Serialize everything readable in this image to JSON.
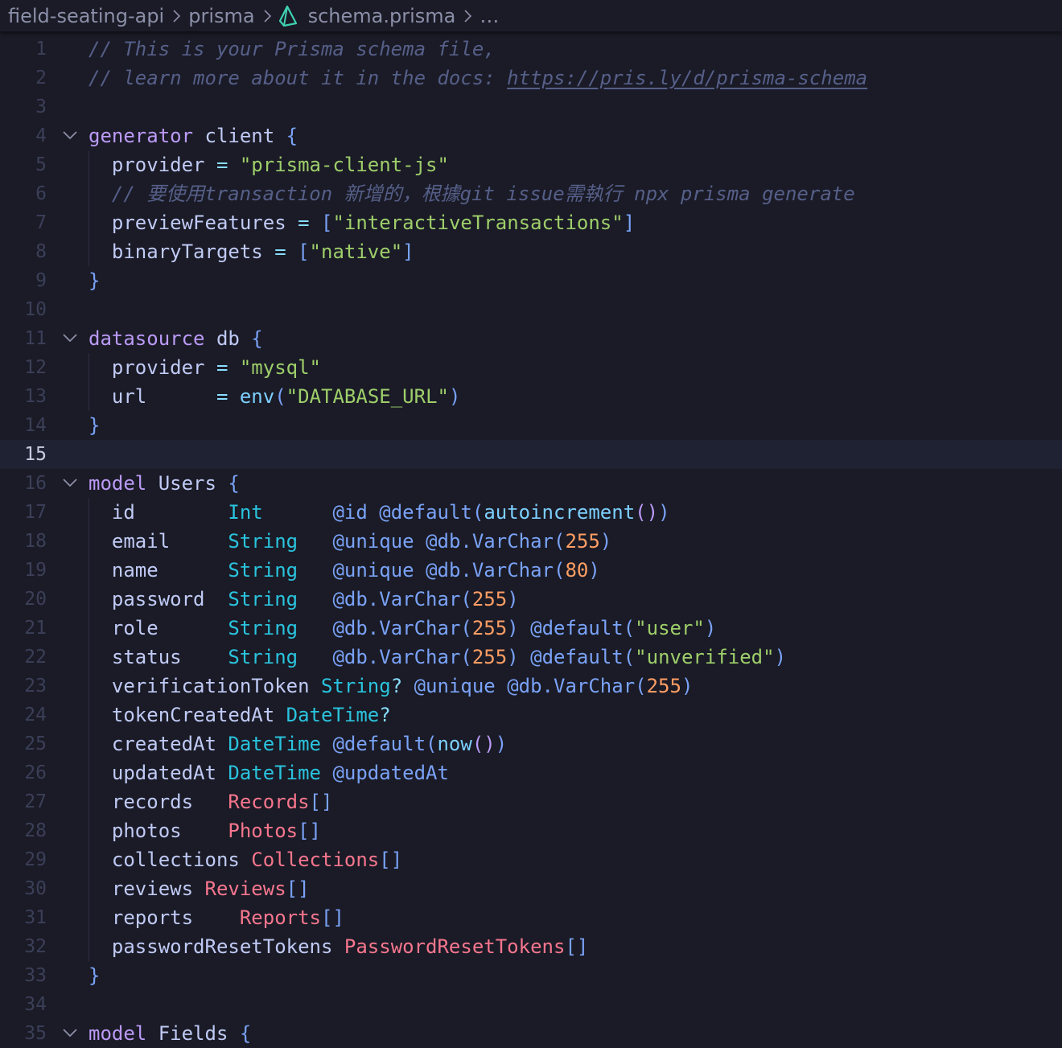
{
  "breadcrumb": {
    "folder": "field-seating-api",
    "subfolder": "prisma",
    "file": "schema.prisma",
    "more": "…",
    "file_icon": "prisma-icon",
    "separator_icon": "chevron-right-icon"
  },
  "editor": {
    "current_line": 15,
    "language": "prisma",
    "lines": [
      {
        "n": "1",
        "fold": false,
        "guide": false,
        "tokens": [
          {
            "t": "// This is your Prisma schema file,",
            "c": "cmt"
          }
        ]
      },
      {
        "n": "2",
        "fold": false,
        "guide": false,
        "tokens": [
          {
            "t": "// learn more about it in the docs: ",
            "c": "cmt"
          },
          {
            "t": "https://pris.ly/d/prisma-schema",
            "c": "cmt url"
          }
        ]
      },
      {
        "n": "3",
        "fold": false,
        "guide": false,
        "tokens": []
      },
      {
        "n": "4",
        "fold": true,
        "guide": false,
        "tokens": [
          {
            "t": "generator",
            "c": "kw"
          },
          {
            "t": " client ",
            "c": "id"
          },
          {
            "t": "{",
            "c": "br"
          }
        ]
      },
      {
        "n": "5",
        "fold": false,
        "guide": true,
        "tokens": [
          {
            "t": "  provider ",
            "c": "id"
          },
          {
            "t": "=",
            "c": "op"
          },
          {
            "t": " ",
            "c": "id"
          },
          {
            "t": "\"prisma-client-js\"",
            "c": "str"
          }
        ]
      },
      {
        "n": "6",
        "fold": false,
        "guide": true,
        "tokens": [
          {
            "t": "  // 要使用transaction 新增的，根據git issue需執行 npx prisma generate",
            "c": "cmt"
          }
        ]
      },
      {
        "n": "7",
        "fold": false,
        "guide": true,
        "tokens": [
          {
            "t": "  previewFeatures ",
            "c": "id"
          },
          {
            "t": "=",
            "c": "op"
          },
          {
            "t": " ",
            "c": "id"
          },
          {
            "t": "[",
            "c": "br"
          },
          {
            "t": "\"interactiveTransactions\"",
            "c": "str"
          },
          {
            "t": "]",
            "c": "br"
          }
        ]
      },
      {
        "n": "8",
        "fold": false,
        "guide": true,
        "tokens": [
          {
            "t": "  binaryTargets ",
            "c": "id"
          },
          {
            "t": "=",
            "c": "op"
          },
          {
            "t": " ",
            "c": "id"
          },
          {
            "t": "[",
            "c": "br"
          },
          {
            "t": "\"native\"",
            "c": "str"
          },
          {
            "t": "]",
            "c": "br"
          }
        ]
      },
      {
        "n": "9",
        "fold": false,
        "guide": false,
        "tokens": [
          {
            "t": "}",
            "c": "br"
          }
        ]
      },
      {
        "n": "10",
        "fold": false,
        "guide": false,
        "tokens": []
      },
      {
        "n": "11",
        "fold": true,
        "guide": false,
        "tokens": [
          {
            "t": "datasource",
            "c": "kw"
          },
          {
            "t": " db ",
            "c": "id"
          },
          {
            "t": "{",
            "c": "br"
          }
        ]
      },
      {
        "n": "12",
        "fold": false,
        "guide": true,
        "tokens": [
          {
            "t": "  provider ",
            "c": "id"
          },
          {
            "t": "=",
            "c": "op"
          },
          {
            "t": " ",
            "c": "id"
          },
          {
            "t": "\"mysql\"",
            "c": "str"
          }
        ]
      },
      {
        "n": "13",
        "fold": false,
        "guide": true,
        "tokens": [
          {
            "t": "  url      ",
            "c": "id"
          },
          {
            "t": "=",
            "c": "op"
          },
          {
            "t": " ",
            "c": "id"
          },
          {
            "t": "env",
            "c": "fn"
          },
          {
            "t": "(",
            "c": "br"
          },
          {
            "t": "\"DATABASE_URL\"",
            "c": "str"
          },
          {
            "t": ")",
            "c": "br"
          }
        ]
      },
      {
        "n": "14",
        "fold": false,
        "guide": false,
        "tokens": [
          {
            "t": "}",
            "c": "br"
          }
        ]
      },
      {
        "n": "15",
        "fold": false,
        "guide": false,
        "tokens": []
      },
      {
        "n": "16",
        "fold": true,
        "guide": false,
        "tokens": [
          {
            "t": "model",
            "c": "kw"
          },
          {
            "t": " Users ",
            "c": "id"
          },
          {
            "t": "{",
            "c": "br"
          }
        ]
      },
      {
        "n": "17",
        "fold": false,
        "guide": true,
        "tokens": [
          {
            "t": "  id        ",
            "c": "id"
          },
          {
            "t": "Int",
            "c": "ty"
          },
          {
            "t": "      ",
            "c": "id"
          },
          {
            "t": "@id",
            "c": "at"
          },
          {
            "t": " ",
            "c": "id"
          },
          {
            "t": "@default",
            "c": "at"
          },
          {
            "t": "(",
            "c": "br"
          },
          {
            "t": "autoincrement",
            "c": "fn"
          },
          {
            "t": "()",
            "c": "kw"
          },
          {
            "t": ")",
            "c": "br"
          }
        ]
      },
      {
        "n": "18",
        "fold": false,
        "guide": true,
        "tokens": [
          {
            "t": "  email     ",
            "c": "id"
          },
          {
            "t": "String",
            "c": "ty"
          },
          {
            "t": "   ",
            "c": "id"
          },
          {
            "t": "@unique",
            "c": "at"
          },
          {
            "t": " ",
            "c": "id"
          },
          {
            "t": "@db.VarChar",
            "c": "at"
          },
          {
            "t": "(",
            "c": "br"
          },
          {
            "t": "255",
            "c": "num"
          },
          {
            "t": ")",
            "c": "br"
          }
        ]
      },
      {
        "n": "19",
        "fold": false,
        "guide": true,
        "tokens": [
          {
            "t": "  name      ",
            "c": "id"
          },
          {
            "t": "String",
            "c": "ty"
          },
          {
            "t": "   ",
            "c": "id"
          },
          {
            "t": "@unique",
            "c": "at"
          },
          {
            "t": " ",
            "c": "id"
          },
          {
            "t": "@db.VarChar",
            "c": "at"
          },
          {
            "t": "(",
            "c": "br"
          },
          {
            "t": "80",
            "c": "num"
          },
          {
            "t": ")",
            "c": "br"
          }
        ]
      },
      {
        "n": "20",
        "fold": false,
        "guide": true,
        "tokens": [
          {
            "t": "  password  ",
            "c": "id"
          },
          {
            "t": "String",
            "c": "ty"
          },
          {
            "t": "   ",
            "c": "id"
          },
          {
            "t": "@db.VarChar",
            "c": "at"
          },
          {
            "t": "(",
            "c": "br"
          },
          {
            "t": "255",
            "c": "num"
          },
          {
            "t": ")",
            "c": "br"
          }
        ]
      },
      {
        "n": "21",
        "fold": false,
        "guide": true,
        "tokens": [
          {
            "t": "  role      ",
            "c": "id"
          },
          {
            "t": "String",
            "c": "ty"
          },
          {
            "t": "   ",
            "c": "id"
          },
          {
            "t": "@db.VarChar",
            "c": "at"
          },
          {
            "t": "(",
            "c": "br"
          },
          {
            "t": "255",
            "c": "num"
          },
          {
            "t": ")",
            "c": "br"
          },
          {
            "t": " ",
            "c": "id"
          },
          {
            "t": "@default",
            "c": "at"
          },
          {
            "t": "(",
            "c": "br"
          },
          {
            "t": "\"user\"",
            "c": "str"
          },
          {
            "t": ")",
            "c": "br"
          }
        ]
      },
      {
        "n": "22",
        "fold": false,
        "guide": true,
        "tokens": [
          {
            "t": "  status    ",
            "c": "id"
          },
          {
            "t": "String",
            "c": "ty"
          },
          {
            "t": "   ",
            "c": "id"
          },
          {
            "t": "@db.VarChar",
            "c": "at"
          },
          {
            "t": "(",
            "c": "br"
          },
          {
            "t": "255",
            "c": "num"
          },
          {
            "t": ")",
            "c": "br"
          },
          {
            "t": " ",
            "c": "id"
          },
          {
            "t": "@default",
            "c": "at"
          },
          {
            "t": "(",
            "c": "br"
          },
          {
            "t": "\"unverified\"",
            "c": "str"
          },
          {
            "t": ")",
            "c": "br"
          }
        ]
      },
      {
        "n": "23",
        "fold": false,
        "guide": true,
        "tokens": [
          {
            "t": "  verificationToken ",
            "c": "id"
          },
          {
            "t": "String",
            "c": "ty"
          },
          {
            "t": "?",
            "c": "op"
          },
          {
            "t": " ",
            "c": "id"
          },
          {
            "t": "@unique",
            "c": "at"
          },
          {
            "t": " ",
            "c": "id"
          },
          {
            "t": "@db.VarChar",
            "c": "at"
          },
          {
            "t": "(",
            "c": "br"
          },
          {
            "t": "255",
            "c": "num"
          },
          {
            "t": ")",
            "c": "br"
          }
        ]
      },
      {
        "n": "24",
        "fold": false,
        "guide": true,
        "tokens": [
          {
            "t": "  tokenCreatedAt ",
            "c": "id"
          },
          {
            "t": "DateTime",
            "c": "ty"
          },
          {
            "t": "?",
            "c": "op"
          }
        ]
      },
      {
        "n": "25",
        "fold": false,
        "guide": true,
        "tokens": [
          {
            "t": "  createdAt ",
            "c": "id"
          },
          {
            "t": "DateTime",
            "c": "ty"
          },
          {
            "t": " ",
            "c": "id"
          },
          {
            "t": "@default",
            "c": "at"
          },
          {
            "t": "(",
            "c": "br"
          },
          {
            "t": "now",
            "c": "fn"
          },
          {
            "t": "()",
            "c": "kw"
          },
          {
            "t": ")",
            "c": "br"
          }
        ]
      },
      {
        "n": "26",
        "fold": false,
        "guide": true,
        "tokens": [
          {
            "t": "  updatedAt ",
            "c": "id"
          },
          {
            "t": "DateTime",
            "c": "ty"
          },
          {
            "t": " ",
            "c": "id"
          },
          {
            "t": "@updatedAt",
            "c": "at"
          }
        ]
      },
      {
        "n": "27",
        "fold": false,
        "guide": true,
        "tokens": [
          {
            "t": "  records   ",
            "c": "id"
          },
          {
            "t": "Records",
            "c": "rel"
          },
          {
            "t": "[]",
            "c": "br"
          }
        ]
      },
      {
        "n": "28",
        "fold": false,
        "guide": true,
        "tokens": [
          {
            "t": "  photos    ",
            "c": "id"
          },
          {
            "t": "Photos",
            "c": "rel"
          },
          {
            "t": "[]",
            "c": "br"
          }
        ]
      },
      {
        "n": "29",
        "fold": false,
        "guide": true,
        "tokens": [
          {
            "t": "  collections ",
            "c": "id"
          },
          {
            "t": "Collections",
            "c": "rel"
          },
          {
            "t": "[]",
            "c": "br"
          }
        ]
      },
      {
        "n": "30",
        "fold": false,
        "guide": true,
        "tokens": [
          {
            "t": "  reviews ",
            "c": "id"
          },
          {
            "t": "Reviews",
            "c": "rel"
          },
          {
            "t": "[]",
            "c": "br"
          }
        ]
      },
      {
        "n": "31",
        "fold": false,
        "guide": true,
        "tokens": [
          {
            "t": "  reports    ",
            "c": "id"
          },
          {
            "t": "Reports",
            "c": "rel"
          },
          {
            "t": "[]",
            "c": "br"
          }
        ]
      },
      {
        "n": "32",
        "fold": false,
        "guide": true,
        "tokens": [
          {
            "t": "  passwordResetTokens ",
            "c": "id"
          },
          {
            "t": "PasswordResetTokens",
            "c": "rel"
          },
          {
            "t": "[]",
            "c": "br"
          }
        ]
      },
      {
        "n": "33",
        "fold": false,
        "guide": false,
        "tokens": [
          {
            "t": "}",
            "c": "br"
          }
        ]
      },
      {
        "n": "34",
        "fold": false,
        "guide": false,
        "tokens": []
      },
      {
        "n": "35",
        "fold": true,
        "guide": false,
        "tokens": [
          {
            "t": "model",
            "c": "kw"
          },
          {
            "t": " Fields ",
            "c": "id"
          },
          {
            "t": "{",
            "c": "br"
          }
        ]
      }
    ]
  }
}
